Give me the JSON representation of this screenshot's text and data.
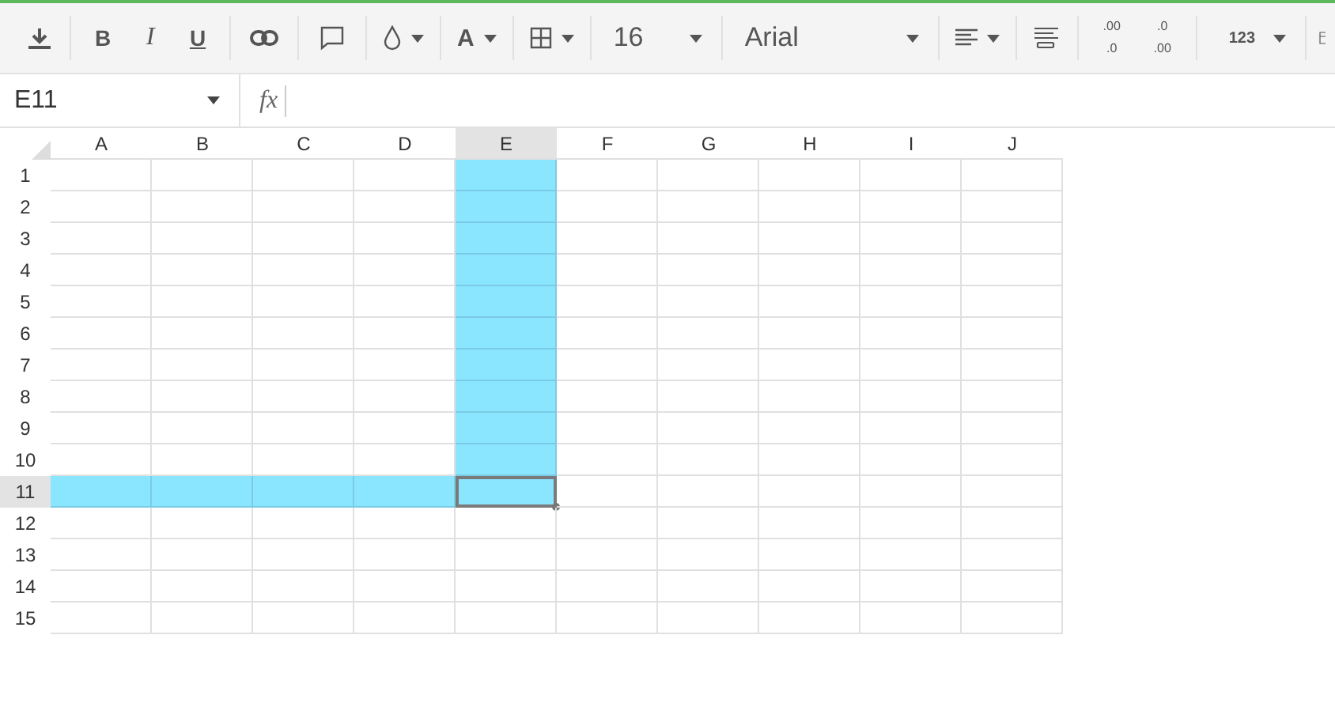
{
  "toolbar": {
    "groups": [
      [
        {
          "kind": "download"
        }
      ],
      [
        {
          "kind": "bold",
          "label": "B"
        },
        {
          "kind": "italic",
          "label": "I"
        },
        {
          "kind": "underline",
          "label": "U"
        }
      ],
      [
        {
          "kind": "link"
        }
      ],
      [
        {
          "kind": "comment"
        }
      ],
      [
        {
          "kind": "fill-color"
        }
      ],
      [
        {
          "kind": "text-color",
          "label": "A"
        }
      ],
      [
        {
          "kind": "borders"
        }
      ],
      [
        {
          "kind": "font-size",
          "label": "16"
        }
      ],
      [
        {
          "kind": "font",
          "label": "Arial"
        }
      ],
      [
        {
          "kind": "align"
        }
      ],
      [
        {
          "kind": "wrap"
        }
      ],
      [
        {
          "kind": "decimal-add",
          "lines": [
            ".00",
            ".0"
          ]
        },
        {
          "kind": "decimal-remove",
          "lines": [
            ".0",
            ".00"
          ]
        }
      ],
      [
        {
          "kind": "number-format",
          "label": "123"
        }
      ],
      [
        {
          "kind": "more"
        }
      ]
    ]
  },
  "formula_bar": {
    "name_box": "E11",
    "fx_label": "fx"
  },
  "sheet": {
    "columns": [
      {
        "label": "A",
        "selected": false
      },
      {
        "label": "B",
        "selected": false
      },
      {
        "label": "C",
        "selected": false
      },
      {
        "label": "D",
        "selected": false
      },
      {
        "label": "E",
        "selected": true
      },
      {
        "label": "F",
        "selected": false
      },
      {
        "label": "G",
        "selected": false
      },
      {
        "label": "H",
        "selected": false
      },
      {
        "label": "I",
        "selected": false
      },
      {
        "label": "J",
        "selected": false
      }
    ],
    "rows": [
      {
        "label": "1",
        "selected": false,
        "highlighted": [
          false,
          false,
          false,
          false,
          true,
          false,
          false,
          false,
          false,
          false
        ],
        "active": [
          false,
          false,
          false,
          false,
          false,
          false,
          false,
          false,
          false,
          false
        ]
      },
      {
        "label": "2",
        "selected": false,
        "highlighted": [
          false,
          false,
          false,
          false,
          true,
          false,
          false,
          false,
          false,
          false
        ],
        "active": [
          false,
          false,
          false,
          false,
          false,
          false,
          false,
          false,
          false,
          false
        ]
      },
      {
        "label": "3",
        "selected": false,
        "highlighted": [
          false,
          false,
          false,
          false,
          true,
          false,
          false,
          false,
          false,
          false
        ],
        "active": [
          false,
          false,
          false,
          false,
          false,
          false,
          false,
          false,
          false,
          false
        ]
      },
      {
        "label": "4",
        "selected": false,
        "highlighted": [
          false,
          false,
          false,
          false,
          true,
          false,
          false,
          false,
          false,
          false
        ],
        "active": [
          false,
          false,
          false,
          false,
          false,
          false,
          false,
          false,
          false,
          false
        ]
      },
      {
        "label": "5",
        "selected": false,
        "highlighted": [
          false,
          false,
          false,
          false,
          true,
          false,
          false,
          false,
          false,
          false
        ],
        "active": [
          false,
          false,
          false,
          false,
          false,
          false,
          false,
          false,
          false,
          false
        ]
      },
      {
        "label": "6",
        "selected": false,
        "highlighted": [
          false,
          false,
          false,
          false,
          true,
          false,
          false,
          false,
          false,
          false
        ],
        "active": [
          false,
          false,
          false,
          false,
          false,
          false,
          false,
          false,
          false,
          false
        ]
      },
      {
        "label": "7",
        "selected": false,
        "highlighted": [
          false,
          false,
          false,
          false,
          true,
          false,
          false,
          false,
          false,
          false
        ],
        "active": [
          false,
          false,
          false,
          false,
          false,
          false,
          false,
          false,
          false,
          false
        ]
      },
      {
        "label": "8",
        "selected": false,
        "highlighted": [
          false,
          false,
          false,
          false,
          true,
          false,
          false,
          false,
          false,
          false
        ],
        "active": [
          false,
          false,
          false,
          false,
          false,
          false,
          false,
          false,
          false,
          false
        ]
      },
      {
        "label": "9",
        "selected": false,
        "highlighted": [
          false,
          false,
          false,
          false,
          true,
          false,
          false,
          false,
          false,
          false
        ],
        "active": [
          false,
          false,
          false,
          false,
          false,
          false,
          false,
          false,
          false,
          false
        ]
      },
      {
        "label": "10",
        "selected": false,
        "highlighted": [
          false,
          false,
          false,
          false,
          true,
          false,
          false,
          false,
          false,
          false
        ],
        "active": [
          false,
          false,
          false,
          false,
          false,
          false,
          false,
          false,
          false,
          false
        ]
      },
      {
        "label": "11",
        "selected": true,
        "highlighted": [
          true,
          true,
          true,
          true,
          true,
          false,
          false,
          false,
          false,
          false
        ],
        "active": [
          false,
          false,
          false,
          false,
          true,
          false,
          false,
          false,
          false,
          false
        ]
      },
      {
        "label": "12",
        "selected": false,
        "highlighted": [
          false,
          false,
          false,
          false,
          false,
          false,
          false,
          false,
          false,
          false
        ],
        "active": [
          false,
          false,
          false,
          false,
          false,
          false,
          false,
          false,
          false,
          false
        ]
      },
      {
        "label": "13",
        "selected": false,
        "highlighted": [
          false,
          false,
          false,
          false,
          false,
          false,
          false,
          false,
          false,
          false
        ],
        "active": [
          false,
          false,
          false,
          false,
          false,
          false,
          false,
          false,
          false,
          false
        ]
      },
      {
        "label": "14",
        "selected": false,
        "highlighted": [
          false,
          false,
          false,
          false,
          false,
          false,
          false,
          false,
          false,
          false
        ],
        "active": [
          false,
          false,
          false,
          false,
          false,
          false,
          false,
          false,
          false,
          false
        ]
      },
      {
        "label": "15",
        "selected": false,
        "highlighted": [
          false,
          false,
          false,
          false,
          false,
          false,
          false,
          false,
          false,
          false
        ],
        "active": [
          false,
          false,
          false,
          false,
          false,
          false,
          false,
          false,
          false,
          false
        ]
      }
    ]
  }
}
